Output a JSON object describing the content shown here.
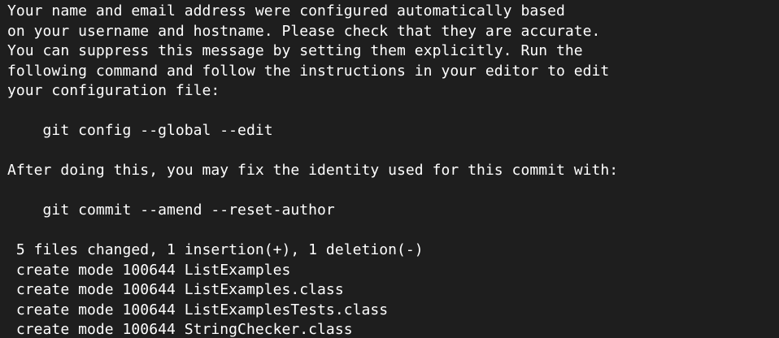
{
  "terminal": {
    "lines": [
      "Your name and email address were configured automatically based",
      "on your username and hostname. Please check that they are accurate.",
      "You can suppress this message by setting them explicitly. Run the",
      "following command and follow the instructions in your editor to edit",
      "your configuration file:",
      "",
      "    git config --global --edit",
      "",
      "After doing this, you may fix the identity used for this commit with:",
      "",
      "    git commit --amend --reset-author",
      "",
      " 5 files changed, 1 insertion(+), 1 deletion(-)",
      " create mode 100644 ListExamples",
      " create mode 100644 ListExamples.class",
      " create mode 100644 ListExamplesTests.class",
      " create mode 100644 StringChecker.class"
    ]
  }
}
